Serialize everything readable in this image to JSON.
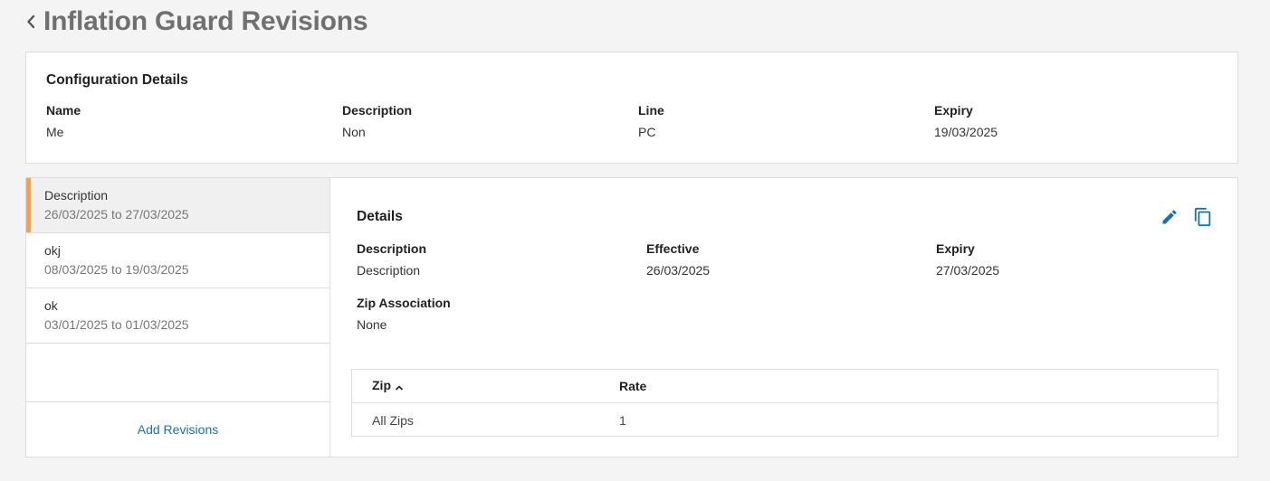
{
  "page": {
    "title": "Inflation Guard Revisions"
  },
  "config": {
    "title": "Configuration Details",
    "fields": [
      {
        "label": "Name",
        "value": "Me"
      },
      {
        "label": "Description",
        "value": "Non"
      },
      {
        "label": "Line",
        "value": "PC"
      },
      {
        "label": "Expiry",
        "value": "19/03/2025"
      }
    ]
  },
  "revisions": {
    "items": [
      {
        "name": "Description",
        "dates": "26/03/2025 to 27/03/2025",
        "active": true
      },
      {
        "name": "okj",
        "dates": "08/03/2025 to 19/03/2025",
        "active": false
      },
      {
        "name": "ok",
        "dates": "03/01/2025 to 01/03/2025",
        "active": false
      }
    ],
    "add_label": "Add Revisions"
  },
  "details": {
    "title": "Details",
    "fields": [
      {
        "label": "Description",
        "value": "Description"
      },
      {
        "label": "Effective",
        "value": "26/03/2025"
      },
      {
        "label": "Expiry",
        "value": "27/03/2025"
      },
      {
        "label": "Zip Association",
        "value": "None"
      }
    ],
    "table": {
      "headers": [
        "Zip",
        "Rate"
      ],
      "rows": [
        [
          "All Zips",
          "1"
        ]
      ]
    }
  },
  "icons": {
    "back": "chevron-left-icon",
    "edit": "pencil-icon",
    "copy": "copy-icon",
    "sort": "chevron-up-icon"
  },
  "colors": {
    "accent": "#1a73a8",
    "active_marker": "#f5a04a",
    "title_gray": "#707070"
  }
}
